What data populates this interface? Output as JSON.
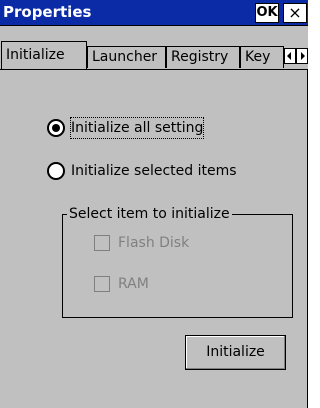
{
  "window": {
    "title": "Properties",
    "ok_label": "OK",
    "close_label": "×"
  },
  "tabs": [
    {
      "label": "Initialize",
      "active": true
    },
    {
      "label": "Launcher",
      "active": false
    },
    {
      "label": "Registry",
      "active": false
    },
    {
      "label": "Key",
      "active": false
    }
  ],
  "tab_scroll": {
    "left_icon": "arrow-left-icon",
    "right_icon": "arrow-right-icon"
  },
  "options": {
    "all_label": "Initialize all setting",
    "all_selected": true,
    "selected_label": "Initialize selected items",
    "selected_selected": false
  },
  "group": {
    "title": "Select item to initialize",
    "items": [
      {
        "label": "Flash Disk",
        "checked": false,
        "enabled": false
      },
      {
        "label": "RAM",
        "checked": false,
        "enabled": false
      }
    ]
  },
  "actions": {
    "initialize_label": "Initialize"
  },
  "colors": {
    "titlebar": "#0a2aa6",
    "face": "#c0c0c0",
    "disabled_text": "#808080"
  }
}
